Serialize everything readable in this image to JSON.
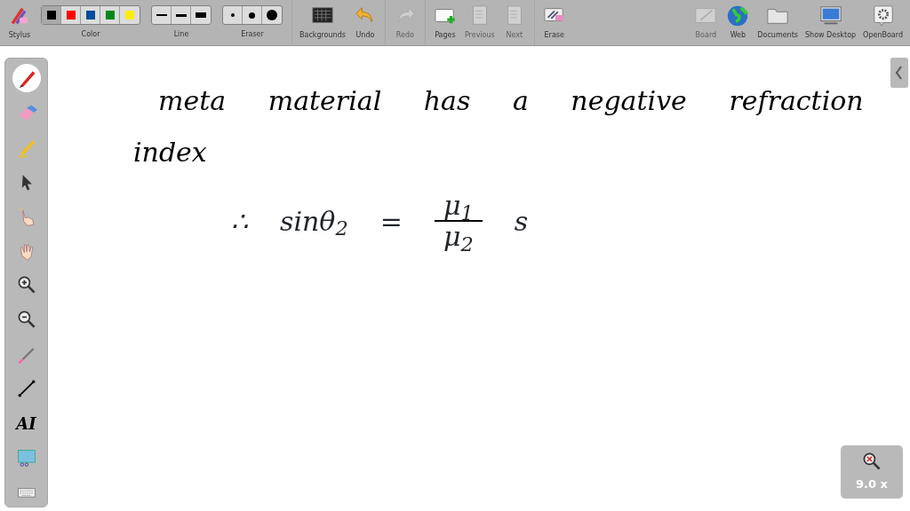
{
  "toolbar": {
    "left": [
      {
        "kind": "button",
        "label": "Stylus",
        "disabled": false
      },
      {
        "kind": "colors",
        "label": "Color",
        "swatches": [
          {
            "color": "#000000",
            "selected": true
          },
          {
            "color": "#ff0000",
            "selected": false
          },
          {
            "color": "#004b9c",
            "selected": false
          },
          {
            "color": "#00891a",
            "selected": false
          },
          {
            "color": "#ffec00",
            "selected": false
          }
        ]
      },
      {
        "kind": "line-sizes",
        "label": "Line",
        "options": [
          {
            "selected": false
          },
          {
            "selected": false
          },
          {
            "selected": false
          }
        ]
      },
      {
        "kind": "eraser-sizes",
        "label": "Eraser",
        "options": [
          {
            "selected": false
          },
          {
            "selected": false
          },
          {
            "selected": false
          }
        ]
      },
      {
        "kind": "button",
        "label": "Backgrounds",
        "disabled": false
      },
      {
        "kind": "button",
        "label": "Undo",
        "disabled": false
      },
      {
        "kind": "button",
        "label": "Redo",
        "disabled": true
      },
      {
        "kind": "button",
        "label": "Pages",
        "disabled": false
      },
      {
        "kind": "button",
        "label": "Previous",
        "disabled": true
      },
      {
        "kind": "button",
        "label": "Next",
        "disabled": true
      },
      {
        "kind": "button",
        "label": "Erase",
        "disabled": false
      }
    ],
    "right": [
      {
        "kind": "button",
        "label": "Board",
        "disabled": true
      },
      {
        "kind": "button",
        "label": "Web",
        "disabled": false
      },
      {
        "kind": "button",
        "label": "Documents",
        "disabled": false
      },
      {
        "kind": "button",
        "label": "Show Desktop",
        "disabled": false
      },
      {
        "kind": "button",
        "label": "OpenBoard",
        "disabled": false
      }
    ]
  },
  "palette": [
    {
      "kind": "pen",
      "selected": true
    },
    {
      "kind": "eraser",
      "selected": false
    },
    {
      "kind": "marker",
      "selected": false
    },
    {
      "kind": "pointer",
      "selected": false
    },
    {
      "kind": "play",
      "selected": false
    },
    {
      "kind": "hand",
      "selected": false
    },
    {
      "kind": "zoom-in",
      "selected": false
    },
    {
      "kind": "zoom-out",
      "selected": false
    },
    {
      "kind": "laser",
      "selected": false
    },
    {
      "kind": "line",
      "selected": false
    },
    {
      "kind": "text",
      "glyph": "AI",
      "selected": false
    },
    {
      "kind": "capture",
      "selected": false
    },
    {
      "kind": "keyboard",
      "selected": false
    }
  ],
  "board": {
    "lines": [
      "meta material has a negative refraction",
      "index"
    ],
    "equation": {
      "prefix": "∴",
      "lhs": "sinθ$_{2}$",
      "op": "=",
      "numerator": "μ$_{1}$",
      "denominator": "μ$_{2}$",
      "suffix": "s"
    }
  },
  "zoom": {
    "reading": "9.0 x"
  }
}
